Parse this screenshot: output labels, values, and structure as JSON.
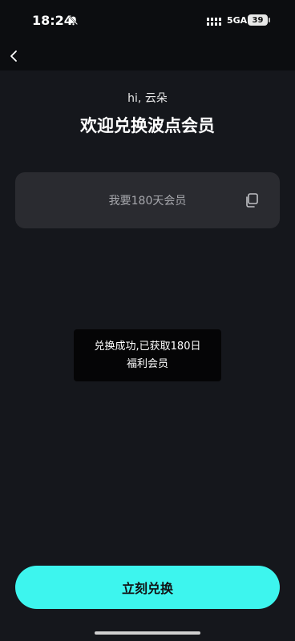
{
  "status_bar": {
    "time": "18:24",
    "network": "5GA",
    "battery": "39",
    "icons": [
      "bell-muted-icon",
      "signal-icon",
      "battery-icon"
    ]
  },
  "nav": {
    "back_icon": "chevron-left-icon"
  },
  "header": {
    "greeting": "hi, 云朵",
    "title": "欢迎兑换波点会员"
  },
  "code_field": {
    "value": "我要180天会员",
    "copy_icon": "copy-icon"
  },
  "toast": {
    "line1": "兑换成功,已获取180日",
    "line2": "福利会员"
  },
  "actions": {
    "redeem_label": "立刻兑换"
  },
  "colors": {
    "background": "#15171c",
    "status_bar": "#0c0d10",
    "input_bg": "#2a2b30",
    "accent": "#3df5ee",
    "toast_bg": "#050506"
  }
}
